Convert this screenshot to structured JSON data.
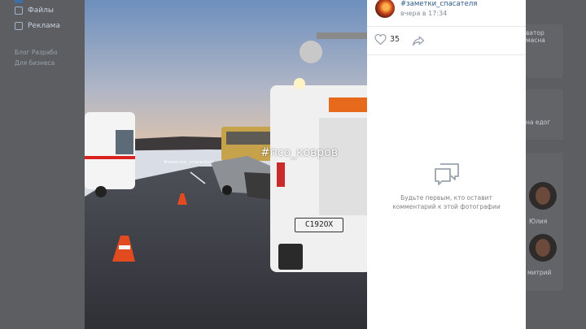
{
  "background_page": {
    "nav": [
      {
        "label": "",
        "icon": "square-icon"
      },
      {
        "label": "Файлы",
        "icon": "clip-icon"
      },
      {
        "label": "Реклама",
        "icon": "megaphone-icon"
      }
    ],
    "footer_line1": "Блог Разрабо",
    "footer_line2": "Для бизнеса",
    "right_snippets": [
      "ватор\nмасна",
      "на едог",
      "Юлия",
      "митрий"
    ]
  },
  "photo": {
    "hashtag_overlay": "#псо_ковров",
    "small_tag": "#заметки_спасателя",
    "plate_text": "С192ОХ"
  },
  "post": {
    "author": "#заметки_спасателя",
    "time": "вчера в 17:34",
    "likes": "35",
    "comments_placeholder_line1": "Будьте первым, кто оставит",
    "comments_placeholder_line2": "комментарий к этой фотографии"
  },
  "colors": {
    "link": "#2a5885",
    "muted": "#818c99"
  }
}
